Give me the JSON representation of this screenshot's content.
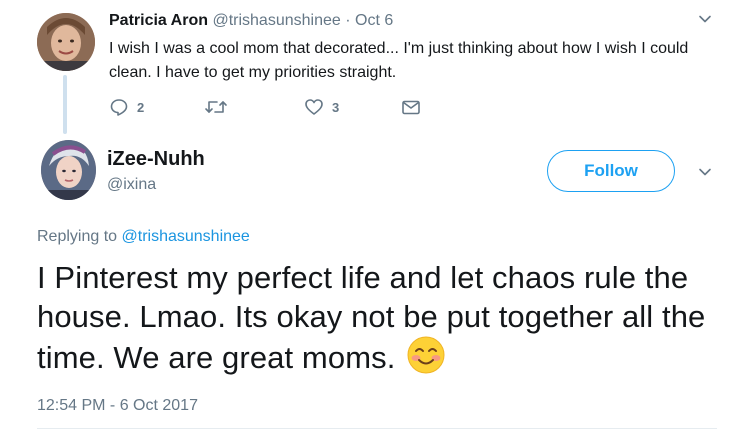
{
  "parent_tweet": {
    "display_name": "Patricia Aron",
    "handle": "@trishasunshinee",
    "separator": "·",
    "date": "Oct 6",
    "text": "I wish I was a cool mom that decorated... I'm just thinking about how I wish I could clean. I have to get my priorities straight.",
    "reply_count": "2",
    "like_count": "3",
    "icons": [
      "reply-icon",
      "retweet-icon",
      "like-icon",
      "direct-message-icon",
      "chevron-down-icon"
    ]
  },
  "reply_tweet": {
    "display_name": "iZee-Nuhh",
    "handle": "@ixina",
    "follow_label": "Follow",
    "replying_prefix": "Replying to",
    "replying_to": "@trishasunshinee",
    "text": "I Pinterest my perfect life and let chaos rule the house. Lmao. Its okay not be put together all the time. We are great moms.",
    "emoji": "blushing-smile-emoji",
    "timestamp": "12:54 PM - 6 Oct 2017"
  },
  "colors": {
    "accent": "#1da1f2",
    "text": "#14171a",
    "muted": "#657786",
    "thread_line": "#cfe0ee"
  }
}
